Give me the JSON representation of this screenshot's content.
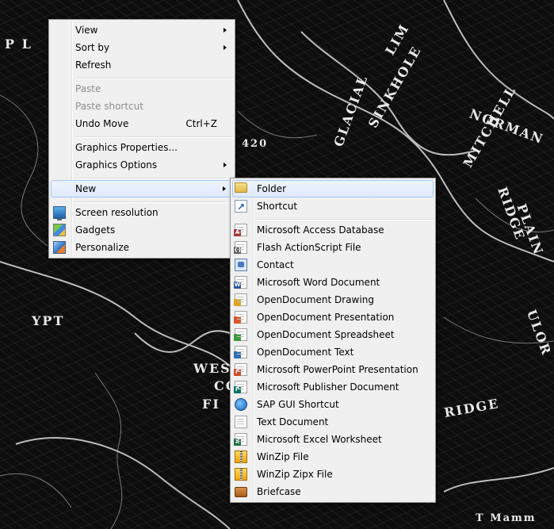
{
  "desktop": {
    "map_labels": [
      "P L",
      "LIM",
      "SINKHOLE",
      "GLACIAL",
      "MITCHELL",
      "NORMAN",
      "420",
      "RIDGE",
      "PLAIN",
      "YPT",
      "WES",
      "CO",
      "FI",
      "RIDGE",
      "ULOR",
      "T Mamm"
    ]
  },
  "context_menu": {
    "items": [
      {
        "label": "View",
        "submenu": true
      },
      {
        "label": "Sort by",
        "submenu": true
      },
      {
        "label": "Refresh"
      },
      {
        "label": "Paste",
        "disabled": true
      },
      {
        "label": "Paste shortcut",
        "disabled": true
      },
      {
        "label": "Undo Move",
        "shortcut": "Ctrl+Z"
      },
      {
        "label": "Graphics Properties..."
      },
      {
        "label": "Graphics Options",
        "submenu": true
      },
      {
        "label": "New",
        "submenu": true,
        "highlighted": true
      },
      {
        "label": "Screen resolution",
        "icon": "screen-resolution-icon"
      },
      {
        "label": "Gadgets",
        "icon": "gadgets-icon"
      },
      {
        "label": "Personalize",
        "icon": "personalize-icon"
      }
    ]
  },
  "new_submenu": {
    "items": [
      {
        "label": "Folder",
        "icon": "folder-icon",
        "highlighted": true
      },
      {
        "label": "Shortcut",
        "icon": "shortcut-icon"
      },
      {
        "label": "Microsoft Access Database",
        "icon": "access-icon"
      },
      {
        "label": "Flash ActionScript File",
        "icon": "actionscript-icon"
      },
      {
        "label": "Contact",
        "icon": "contact-icon"
      },
      {
        "label": "Microsoft Word Document",
        "icon": "word-icon"
      },
      {
        "label": "OpenDocument Drawing",
        "icon": "odg-icon"
      },
      {
        "label": "OpenDocument Presentation",
        "icon": "odp-icon"
      },
      {
        "label": "OpenDocument Spreadsheet",
        "icon": "ods-icon"
      },
      {
        "label": "OpenDocument Text",
        "icon": "odt-icon"
      },
      {
        "label": "Microsoft PowerPoint Presentation",
        "icon": "powerpoint-icon"
      },
      {
        "label": "Microsoft Publisher Document",
        "icon": "publisher-icon"
      },
      {
        "label": "SAP GUI Shortcut",
        "icon": "sap-icon"
      },
      {
        "label": "Text Document",
        "icon": "text-document-icon"
      },
      {
        "label": "Microsoft Excel Worksheet",
        "icon": "excel-icon"
      },
      {
        "label": "WinZip File",
        "icon": "winzip-icon"
      },
      {
        "label": "WinZip Zipx File",
        "icon": "winzip-zipx-icon"
      },
      {
        "label": "Briefcase",
        "icon": "briefcase-icon"
      }
    ]
  },
  "colors": {
    "menu_bg": "#f0f0f0",
    "highlight": "#dde9fb",
    "disabled_text": "#8d8d8d",
    "access": "#a4373a",
    "word": "#2b5797",
    "ppt": "#d24726",
    "publisher": "#077568",
    "excel": "#1e7145",
    "odg": "#e0a21b",
    "odp": "#d9562b",
    "ods": "#3a9a3a",
    "odt": "#2f6fb5",
    "flash": "#5a5a5a"
  }
}
